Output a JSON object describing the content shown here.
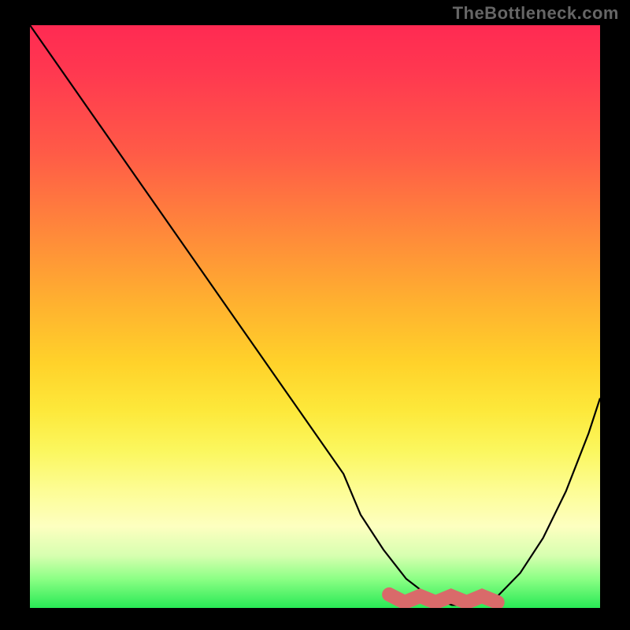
{
  "watermark": "TheBottleneck.com",
  "chart_data": {
    "type": "line",
    "title": "",
    "xlabel": "",
    "ylabel": "",
    "xlim": [
      0,
      100
    ],
    "ylim": [
      0,
      100
    ],
    "grid": false,
    "legend": false,
    "series": [
      {
        "name": "bottleneck-curve",
        "color": "#000000",
        "x": [
          0,
          5,
          10,
          15,
          20,
          25,
          30,
          35,
          40,
          45,
          50,
          55,
          58,
          62,
          66,
          70,
          74,
          78,
          82,
          86,
          90,
          94,
          98,
          100
        ],
        "y": [
          100,
          93,
          86,
          79,
          72,
          65,
          58,
          51,
          44,
          37,
          30,
          23,
          16,
          10,
          5,
          2,
          0.5,
          0.5,
          2,
          6,
          12,
          20,
          30,
          36
        ]
      }
    ],
    "highlight": {
      "name": "sweet-spot",
      "color": "#d96a6a",
      "x_range": [
        63,
        82
      ],
      "y": 1.5,
      "thickness": 3
    },
    "gradient_stops": [
      {
        "pos": 0.0,
        "color": "#ff2a52"
      },
      {
        "pos": 0.36,
        "color": "#ff8a3a"
      },
      {
        "pos": 0.58,
        "color": "#ffd22a"
      },
      {
        "pos": 0.8,
        "color": "#fdfd96"
      },
      {
        "pos": 1.0,
        "color": "#28e955"
      }
    ]
  }
}
